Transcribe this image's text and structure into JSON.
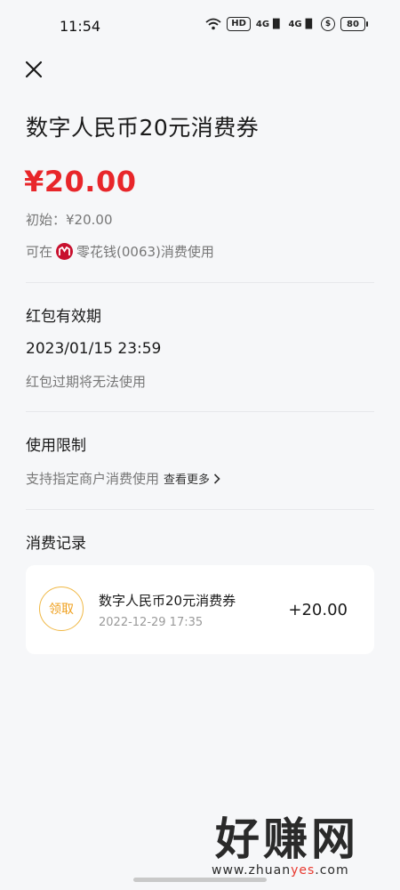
{
  "status_bar": {
    "time": "11:54",
    "hd_label": "HD",
    "signal1_label": "4G",
    "signal2_label": "4G",
    "battery": "80"
  },
  "header": {
    "title": "数字人民币20元消费券"
  },
  "coupon": {
    "amount": "¥20.00",
    "initial": "初始：¥20.00",
    "usable_prefix": "可在",
    "usable_suffix": "零花钱(0063)消费使用"
  },
  "validity": {
    "title": "红包有效期",
    "date": "2023/01/15 23:59",
    "note": "红包过期将无法使用"
  },
  "restrictions": {
    "title": "使用限制",
    "text": "支持指定商户消费使用",
    "see_more": "查看更多"
  },
  "records": {
    "title": "消费记录",
    "items": [
      {
        "badge": "领取",
        "title": "数字人民币20元消费券",
        "time": "2022-12-29 17:35",
        "amount": "+20.00"
      }
    ]
  },
  "watermark": {
    "text": "好赚网",
    "url_prefix": "www.zhuan",
    "url_highlight": "yes",
    "url_suffix": ".com"
  },
  "colors": {
    "accent_red": "#e8262a",
    "badge_orange": "#ef9f1c"
  }
}
